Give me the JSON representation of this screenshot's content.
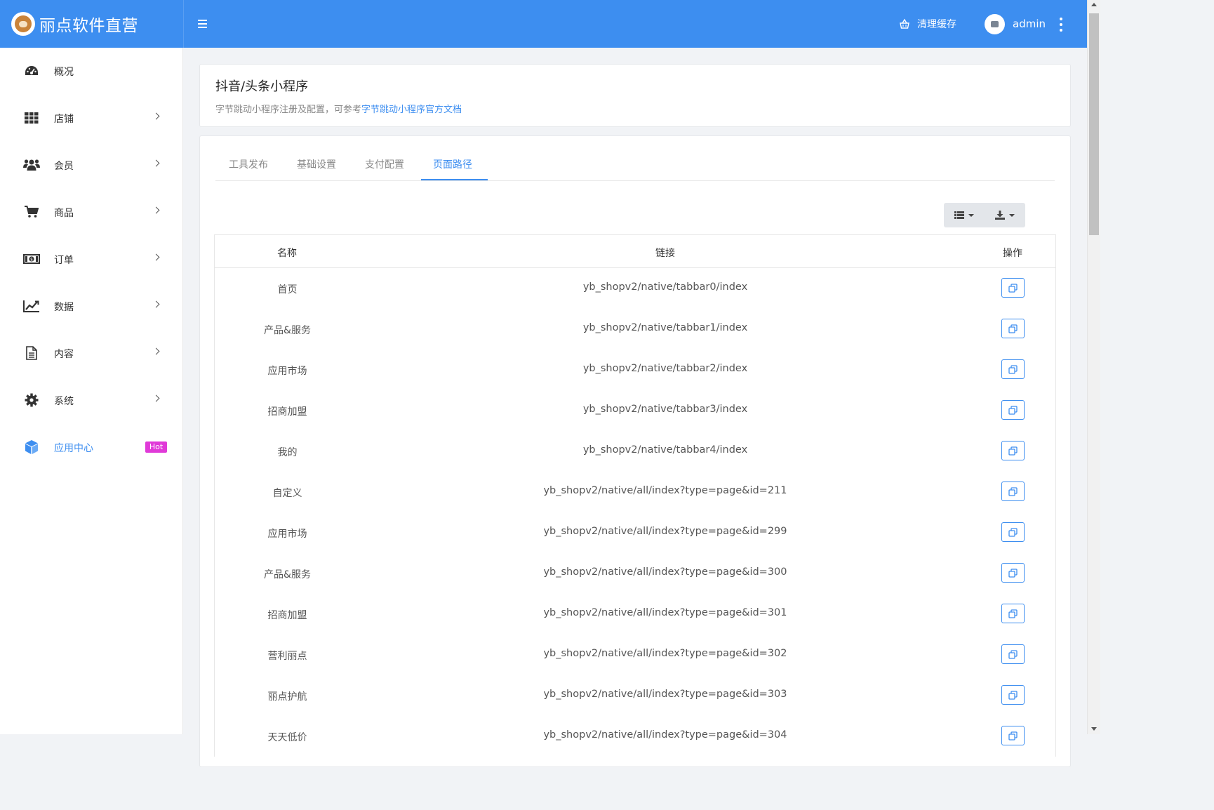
{
  "header": {
    "brand_name": "丽点软件直营",
    "clear_cache_label": "清理缓存",
    "username": "admin",
    "accent_color": "#3d8ef0"
  },
  "sidebar": {
    "items": [
      {
        "label": "概况",
        "icon": "dashboard-icon",
        "has_children": false
      },
      {
        "label": "店铺",
        "icon": "grid-icon",
        "has_children": true
      },
      {
        "label": "会员",
        "icon": "users-icon",
        "has_children": true
      },
      {
        "label": "商品",
        "icon": "cart-icon",
        "has_children": true
      },
      {
        "label": "订单",
        "icon": "money-icon",
        "has_children": true
      },
      {
        "label": "数据",
        "icon": "chart-line-icon",
        "has_children": true
      },
      {
        "label": "内容",
        "icon": "document-icon",
        "has_children": true
      },
      {
        "label": "系统",
        "icon": "gear-icon",
        "has_children": true
      },
      {
        "label": "应用中心",
        "icon": "cube-icon",
        "badge": "Hot",
        "active": true
      }
    ]
  },
  "page": {
    "title": "抖音/头条小程序",
    "description": "字节跳动小程序注册及配置，可参考",
    "doc_link": "字节跳动小程序官方文档"
  },
  "tabs": [
    {
      "label": "工具发布",
      "active": false
    },
    {
      "label": "基础设置",
      "active": false
    },
    {
      "label": "支付配置",
      "active": false
    },
    {
      "label": "页面路径",
      "active": true
    }
  ],
  "table": {
    "headers": [
      "名称",
      "链接",
      "操作"
    ],
    "rows": [
      {
        "name": "首页",
        "link": "yb_shopv2/native/tabbar0/index"
      },
      {
        "name": "产品&服务",
        "link": "yb_shopv2/native/tabbar1/index"
      },
      {
        "name": "应用市场",
        "link": "yb_shopv2/native/tabbar2/index"
      },
      {
        "name": "招商加盟",
        "link": "yb_shopv2/native/tabbar3/index"
      },
      {
        "name": "我的",
        "link": "yb_shopv2/native/tabbar4/index"
      },
      {
        "name": "自定义",
        "link": "yb_shopv2/native/all/index?type=page&id=211"
      },
      {
        "name": "应用市场",
        "link": "yb_shopv2/native/all/index?type=page&id=299"
      },
      {
        "name": "产品&服务",
        "link": "yb_shopv2/native/all/index?type=page&id=300"
      },
      {
        "name": "招商加盟",
        "link": "yb_shopv2/native/all/index?type=page&id=301"
      },
      {
        "name": "营利丽点",
        "link": "yb_shopv2/native/all/index?type=page&id=302"
      },
      {
        "name": "丽点护航",
        "link": "yb_shopv2/native/all/index?type=page&id=303"
      },
      {
        "name": "天天低价",
        "link": "yb_shopv2/native/all/index?type=page&id=304"
      }
    ]
  }
}
